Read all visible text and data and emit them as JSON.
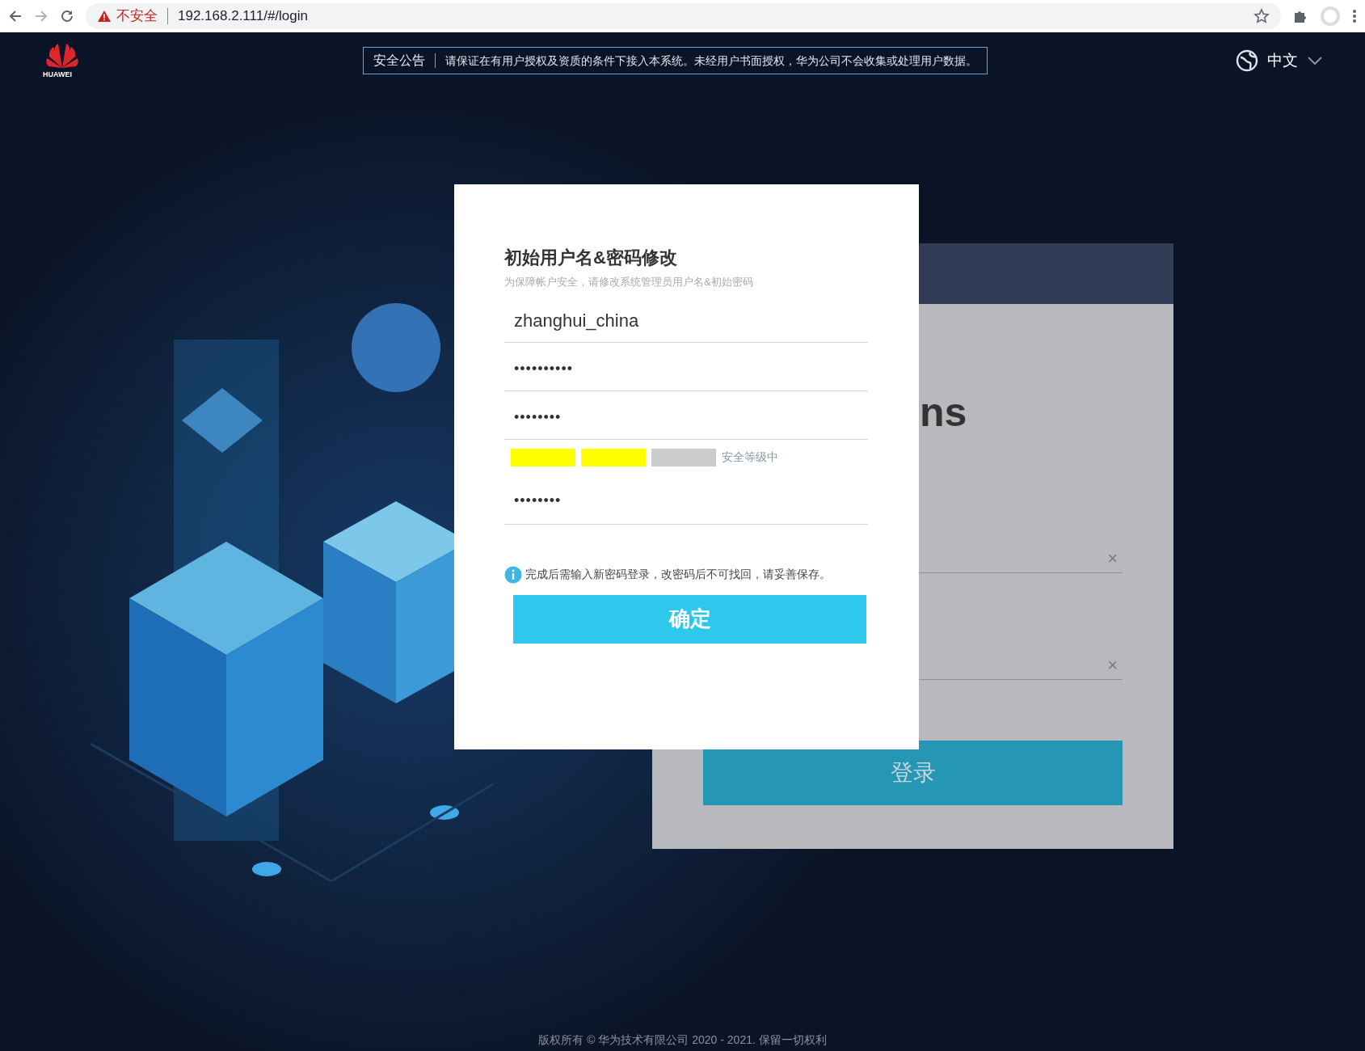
{
  "browser": {
    "security_label": "不安全",
    "url": "192.168.2.111/#/login"
  },
  "header": {
    "logo_text": "HUAWEI",
    "notice": {
      "label": "安全公告",
      "text": "请保证在有用户授权及资质的条件下接入本系统。未经用户书面授权，华为公司不会收集或处理用户数据。"
    },
    "language": "中文"
  },
  "login_panel": {
    "title_fragment": "ns",
    "clear_buttons": [
      "×",
      "×"
    ],
    "login_button": "登录"
  },
  "dialog": {
    "title": "初始用户名&密码修改",
    "subtitle": "为保障帐户安全，请修改系统管理员用户名&初始密码",
    "fields": [
      {
        "kind": "text",
        "value": "zhanghui_china"
      },
      {
        "kind": "password",
        "value": "••••••••••"
      },
      {
        "kind": "password",
        "value": "••••••••"
      },
      {
        "kind": "strength",
        "segments": [
          {
            "filled": true
          },
          {
            "filled": true
          },
          {
            "filled": false
          }
        ],
        "label": "安全等级中"
      },
      {
        "kind": "password",
        "value": "••••••••"
      }
    ],
    "note": "完成后需输入新密码登录，改密码后不可找回，请妥善保存。",
    "confirm_button": "确定"
  },
  "footer": "版权所有 © 华为技术有限公司 2020 - 2021. 保留一切权利"
}
